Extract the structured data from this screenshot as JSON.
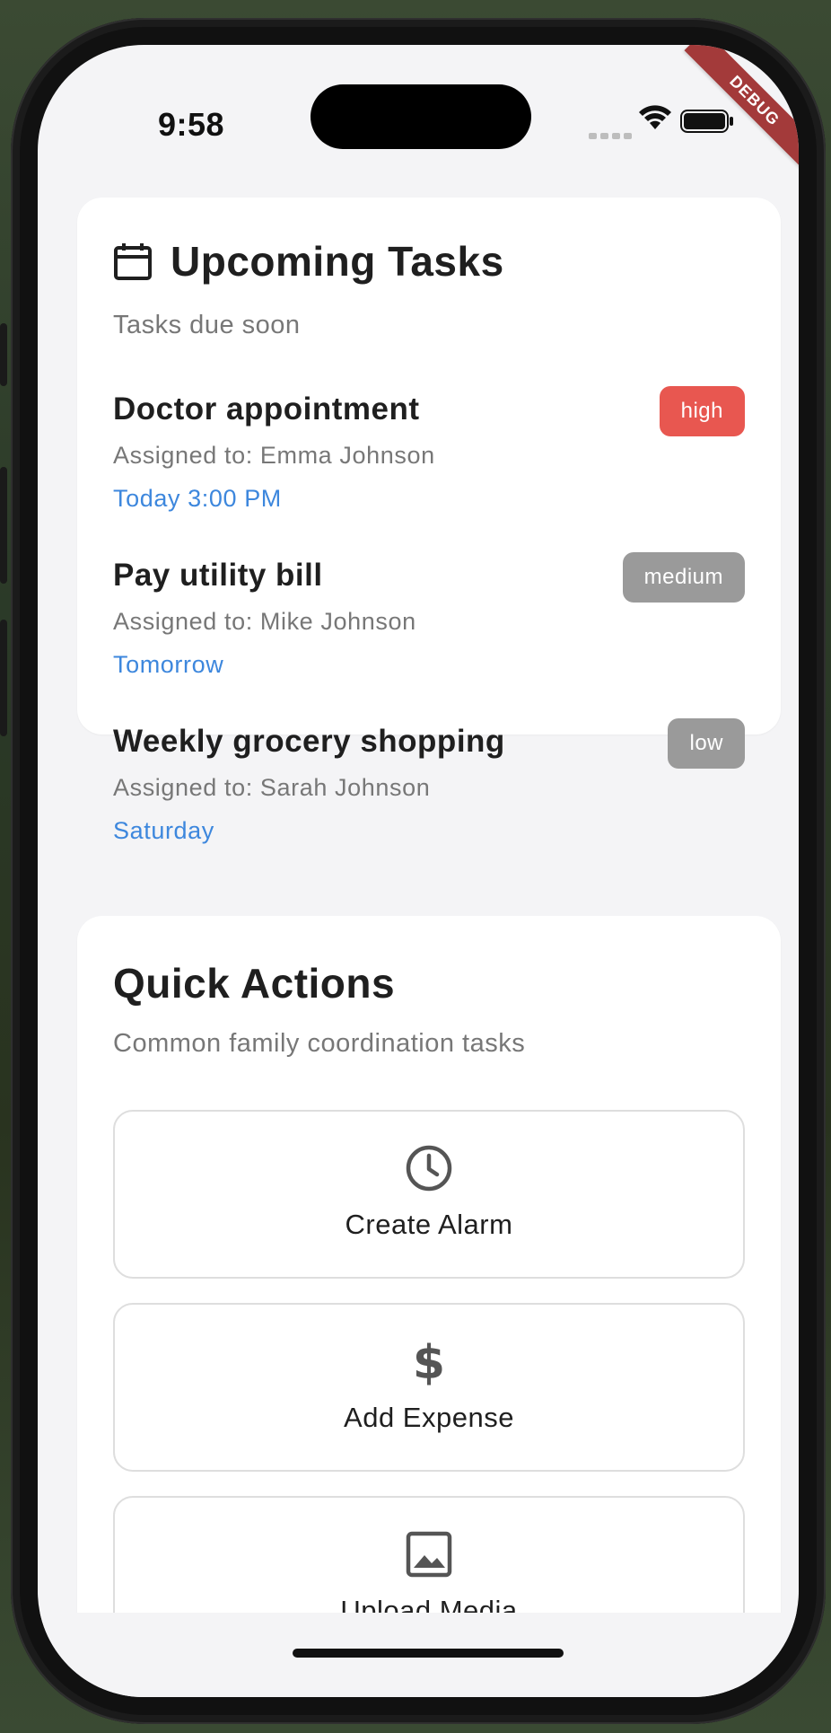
{
  "status_bar": {
    "time": "9:58",
    "debug_label": "DEBUG"
  },
  "upcoming_tasks": {
    "title": "Upcoming Tasks",
    "subtitle": "Tasks due soon",
    "icon": "calendar-icon",
    "items": [
      {
        "title": "Doctor appointment",
        "assigned": "Assigned to: Emma Johnson",
        "when": "Today 3:00 PM",
        "priority": "high",
        "priority_color": "#e85750"
      },
      {
        "title": "Pay utility bill",
        "assigned": "Assigned to: Mike Johnson",
        "when": "Tomorrow",
        "priority": "medium",
        "priority_color": "#9a9a9a"
      },
      {
        "title": "Weekly grocery shopping",
        "assigned": "Assigned to: Sarah Johnson",
        "when": "Saturday",
        "priority": "low",
        "priority_color": "#9a9a9a"
      }
    ]
  },
  "quick_actions": {
    "title": "Quick Actions",
    "subtitle": "Common family coordination tasks",
    "items": [
      {
        "label": "Create Alarm",
        "icon": "clock-icon"
      },
      {
        "label": "Add Expense",
        "icon": "dollar-icon"
      },
      {
        "label": "Upload Media",
        "icon": "image-icon"
      }
    ]
  },
  "colors": {
    "accent_blue": "#3d87dd",
    "high_red": "#e85750",
    "muted_grey": "#9a9a9a",
    "screen_bg": "#f4f4f6"
  }
}
